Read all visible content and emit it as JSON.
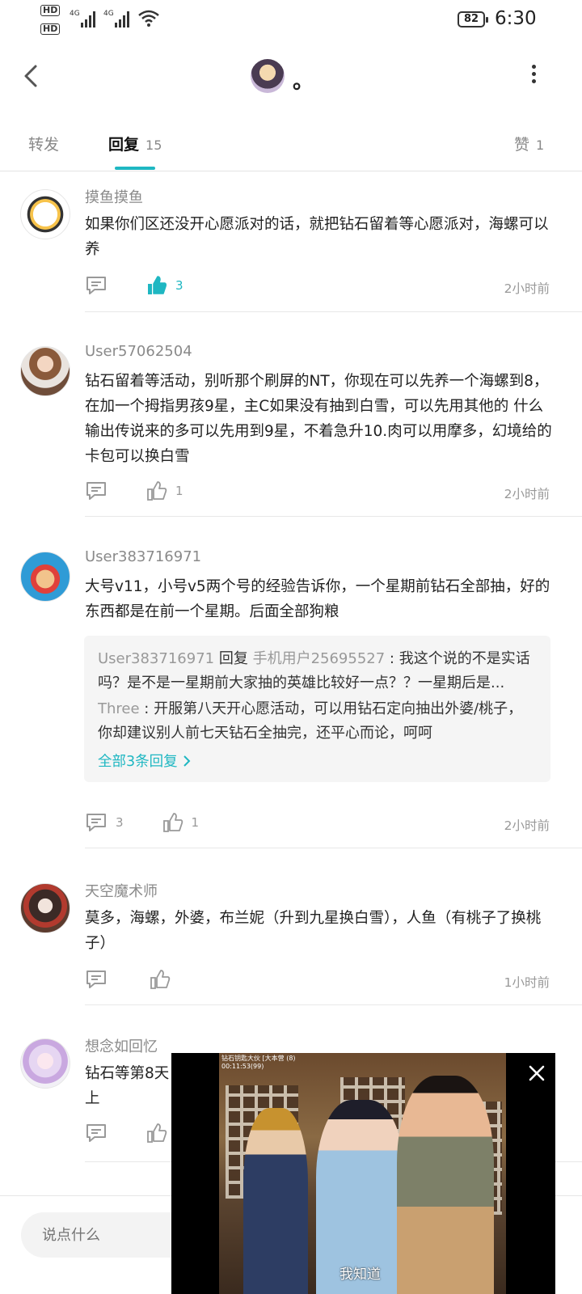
{
  "status_bar": {
    "hd1": "HD",
    "hd2": "HD",
    "net1": "4G",
    "net2": "4G",
    "battery": "82",
    "time": "6:30"
  },
  "header": {
    "title": "。",
    "back_icon": "chevron-left-icon",
    "more_icon": "more-vertical-icon"
  },
  "tabs": {
    "forward": "转发",
    "reply": "回复",
    "reply_count": "15",
    "like": "赞",
    "like_count": "1"
  },
  "comments": [
    {
      "user": "摸鱼摸鱼",
      "text": "如果你们区还没开心愿派对的话，就把钻石留着等心愿派对，海螺可以养",
      "likes": "3",
      "liked": true,
      "time": "2小时前"
    },
    {
      "user": "User57062504",
      "text": "钻石留着等活动，别听那个刷屏的NT，你现在可以先养一个海螺到8，在加一个拇指男孩9星，主C如果没有抽到白雪，可以先用其他的 什么输出传说来的多可以先用到9星，不着急升10.肉可以用摩多，幻境给的卡包可以换白雪",
      "likes": "1",
      "time": "2小时前"
    },
    {
      "user": "User383716971",
      "text": "大号v11，小号v5两个号的经验告诉你，一个星期前钻石全部抽，好的东西都是在前一个星期。后面全部狗粮",
      "replies": [
        {
          "from": "User383716971",
          "verb": "回复",
          "to": "手机用户25695527",
          "text": "我这个说的不是实话吗？是不是一星期前大家抽的英雄比较好一点？？一星期后是..."
        },
        {
          "from": "Three",
          "text": "开服第八天开心愿活动，可以用钻石定向抽出外婆/桃子，你却建议别人前七天钻石全抽完，还平心而论，呵呵"
        }
      ],
      "more_replies": "全部3条回复",
      "comments_count": "3",
      "likes": "1",
      "time": "2小时前"
    },
    {
      "user": "天空魔术师",
      "text": "莫多，海螺，外婆，布兰妮（升到九星换白雪），人鱼（有桃子了换桃子）",
      "time": "1小时前"
    },
    {
      "user": "想念如回忆",
      "text_line1": "钻石等第8天",
      "text_line2": "上"
    }
  ],
  "input": {
    "placeholder": "说点什么"
  },
  "video": {
    "caption": "我知道",
    "osd_line1": "钻石钥匙大伙 [大本营 (8)",
    "osd_line2": "00:11:53(99)",
    "close_icon": "close-icon"
  },
  "colors": {
    "accent": "#1fb7c2",
    "text": "#222222",
    "muted": "#999999"
  }
}
